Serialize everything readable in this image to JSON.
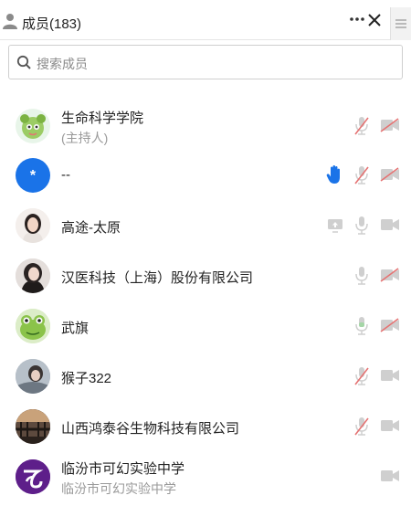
{
  "header": {
    "title": "成员(183)",
    "icons": [
      "user-icon",
      "more-icon",
      "close-icon",
      "menu-icon"
    ]
  },
  "search": {
    "placeholder": "搜索成员"
  },
  "members": [
    {
      "name": "生命科学学院",
      "role": "(主持人)",
      "avatar": "green-cartoon-avatar",
      "mic": "muted",
      "video": "off"
    },
    {
      "name": "--",
      "avatar_text": "*",
      "avatar": "blue-initial-avatar",
      "hand": "raised",
      "mic": "muted",
      "video": "off"
    },
    {
      "name": "高途-太原",
      "avatar": "photo-avatar",
      "screen_share": "available",
      "mic": "on",
      "video": "on"
    },
    {
      "name": "汉医科技（上海）股份有限公司",
      "avatar": "photo-avatar",
      "mic": "on",
      "video": "off"
    },
    {
      "name": "武旗",
      "avatar": "frog-avatar",
      "mic": "speaking",
      "video": "off"
    },
    {
      "name": "猴子322",
      "avatar": "photo-avatar",
      "mic": "muted",
      "video": "on"
    },
    {
      "name": "山西鸿泰谷生物科技有限公司",
      "avatar": "photo-avatar",
      "mic": "muted",
      "video": "on"
    },
    {
      "name": "临汾市可幻实验中学",
      "subtitle": "临汾市可幻实验中学",
      "avatar": "purple-logo-avatar",
      "video": "on"
    }
  ],
  "colors": {
    "accent_blue": "#1a73e8",
    "muted_red": "#e57373",
    "icon_gray": "#c4c4c4",
    "speaking_green": "#a5d6a7"
  }
}
